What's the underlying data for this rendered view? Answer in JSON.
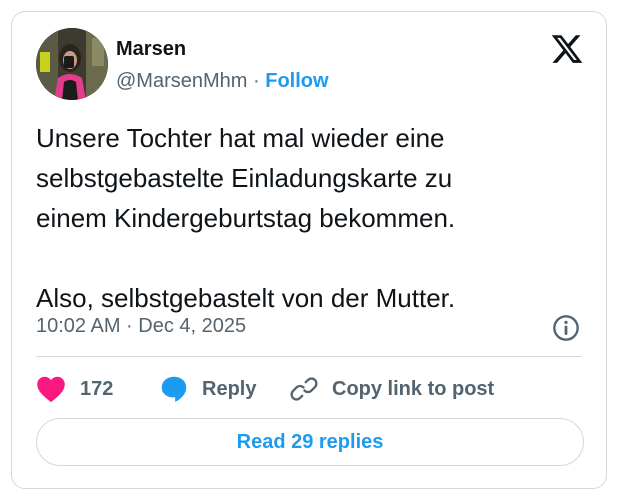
{
  "author": {
    "name": "Marsen",
    "handle": "@MarsenMhm",
    "separator": "·",
    "follow_label": "Follow"
  },
  "tweet": {
    "text": "Unsere Tochter hat mal wieder eine\nselbstgebastelte Einladungskarte zu\neinem Kindergeburtstag bekommen.\n\nAlso, selbstgebastelt von der Mutter.",
    "timestamp": "10:02 AM · Dec 4, 2025"
  },
  "actions": {
    "like_count": "172",
    "reply_label": "Reply",
    "copy_link_label": "Copy link to post"
  },
  "read_replies_label": "Read 29 replies",
  "icons": {
    "logo": "x-logo-icon",
    "info": "info-icon",
    "like": "heart-icon",
    "reply": "speech-bubble-icon",
    "copy": "link-icon"
  },
  "colors": {
    "accent": "#1d9bf0",
    "like": "#f91880",
    "muted_text": "#536471",
    "text": "#0f1419",
    "border": "#cfd9de"
  }
}
